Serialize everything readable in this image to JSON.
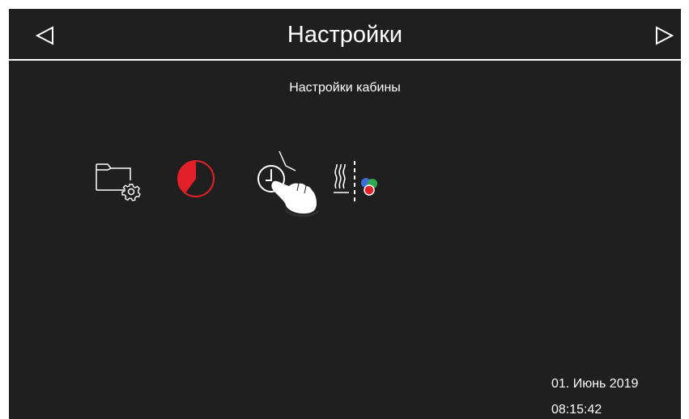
{
  "header": {
    "title": "Настройки",
    "prev_icon": "triangle-left-icon",
    "next_icon": "triangle-right-icon"
  },
  "section": {
    "subtitle": "Настройки кабины"
  },
  "icons": [
    {
      "name": "folder-settings-icon"
    },
    {
      "name": "schedule-pie-icon"
    },
    {
      "name": "clock-touch-icon"
    },
    {
      "name": "steam-color-icon"
    }
  ],
  "footer": {
    "date": "01. Июнь 2019",
    "time": "08:15:42"
  },
  "colors": {
    "background": "#1f1f1f",
    "frame": "#ffffff",
    "text": "#ffffff",
    "accent_red": "#e3202a",
    "dot_blue": "#3a6fd8",
    "dot_green": "#2fa84f"
  }
}
